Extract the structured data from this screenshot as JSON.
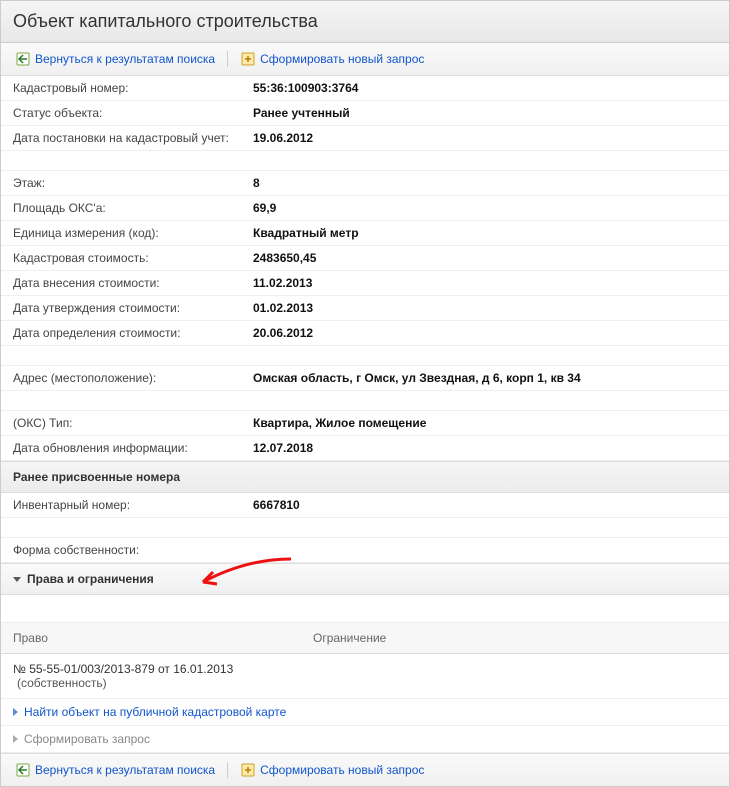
{
  "header": {
    "title": "Объект капитального строительства"
  },
  "toolbar": {
    "back_label": "Вернуться к результатам поиска",
    "new_query_label": "Сформировать новый запрос"
  },
  "fields": {
    "cadastral_number": {
      "label": "Кадастровый номер:",
      "value": "55:36:100903:3764"
    },
    "status": {
      "label": "Статус объекта:",
      "value": "Ранее учтенный"
    },
    "reg_date": {
      "label": "Дата постановки на кадастровый учет:",
      "value": "19.06.2012"
    },
    "floor": {
      "label": "Этаж:",
      "value": "8"
    },
    "area": {
      "label": "Площадь ОКС'a:",
      "value": "69,9"
    },
    "unit": {
      "label": "Единица измерения (код):",
      "value": "Квадратный метр"
    },
    "cadastral_value": {
      "label": "Кадастровая стоимость:",
      "value": "2483650,45"
    },
    "value_entered_date": {
      "label": "Дата внесения стоимости:",
      "value": "11.02.2013"
    },
    "value_approved_date": {
      "label": "Дата утверждения стоимости:",
      "value": "01.02.2013"
    },
    "value_determined_date": {
      "label": "Дата определения стоимости:",
      "value": "20.06.2012"
    },
    "address": {
      "label": "Адрес (местоположение):",
      "value": "Омская область, г Омск, ул Звездная, д 6, корп 1, кв 34"
    },
    "oks_type": {
      "label": "(ОКС) Тип:",
      "value": "Квартира, Жилое помещение"
    },
    "info_updated": {
      "label": "Дата обновления информации:",
      "value": "12.07.2018"
    }
  },
  "sections": {
    "prev_numbers": "Ранее присвоенные номера",
    "inventory": {
      "label": "Инвентарный номер:",
      "value": "6667810"
    },
    "ownership_form": {
      "label": "Форма собственности:",
      "value": ""
    },
    "rights": "Права и ограничения"
  },
  "rights_table": {
    "col1": "Право",
    "col2": "Ограничение",
    "record_text": "№ 55-55-01/003/2013-879  от 16.01.2013",
    "record_sub": "(собственность)"
  },
  "links": {
    "find_on_map": "Найти объект на публичной кадастровой карте",
    "form_request": "Сформировать запрос"
  }
}
